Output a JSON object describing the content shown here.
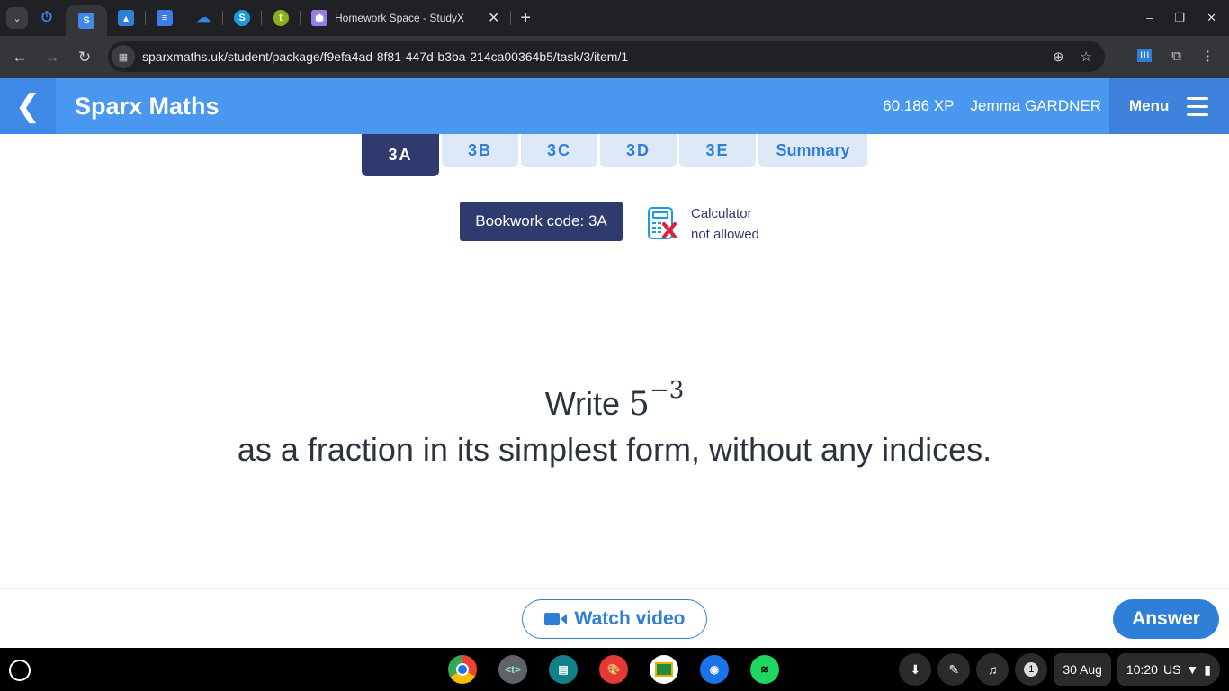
{
  "browser": {
    "active_tab_title": "Homework Space - StudyX",
    "url": "sparxmaths.uk/student/package/f9efa4ad-8f81-447d-b3ba-214ca00364b5/task/3/item/1"
  },
  "header": {
    "brand": "Sparx Maths",
    "xp": "60,186 XP",
    "user": "Jemma GARDNER",
    "menu": "Menu"
  },
  "tabs": [
    {
      "label": "3A",
      "active": true
    },
    {
      "label": "3B"
    },
    {
      "label": "3C"
    },
    {
      "label": "3D"
    },
    {
      "label": "3E"
    },
    {
      "label": "Summary"
    }
  ],
  "bookwork": "Bookwork code: 3A",
  "calculator": {
    "line1": "Calculator",
    "line2": "not allowed"
  },
  "question": {
    "prefix": "Write ",
    "base": "5",
    "exponent": "−3",
    "suffix": " as a fraction in its simplest form, without any indices."
  },
  "footer": {
    "watch_video": "Watch video",
    "answer": "Answer"
  },
  "shelf": {
    "notifications": "1",
    "date": "30 Aug",
    "time": "10:20",
    "locale": "US"
  },
  "colors": {
    "header": "#4a97f0",
    "navy": "#2f3b6e",
    "accent": "#2f7fd8"
  }
}
